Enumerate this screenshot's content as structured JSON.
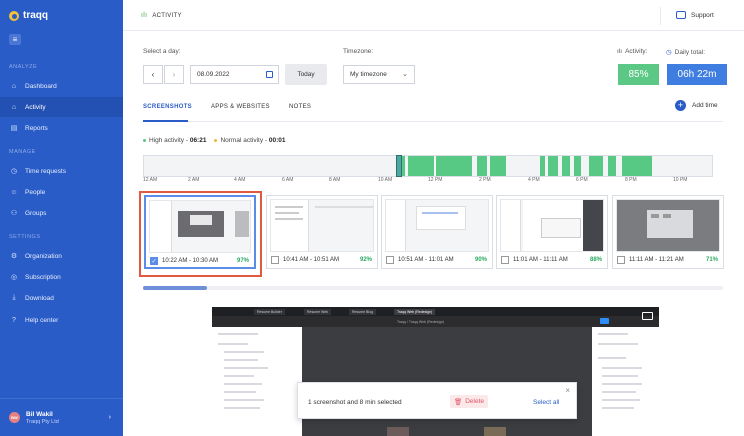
{
  "brand": {
    "name": "traqq"
  },
  "sidebar": {
    "sections": [
      {
        "label": "ANALYZE",
        "items": [
          {
            "label": "Dashboard",
            "icon": "home-icon"
          },
          {
            "label": "Activity",
            "icon": "activity-icon",
            "active": true
          },
          {
            "label": "Reports",
            "icon": "reports-icon"
          }
        ]
      },
      {
        "label": "MANAGE",
        "items": [
          {
            "label": "Time requests",
            "icon": "clock-icon"
          },
          {
            "label": "People",
            "icon": "people-icon"
          },
          {
            "label": "Groups",
            "icon": "groups-icon"
          }
        ]
      },
      {
        "label": "SETTINGS",
        "items": [
          {
            "label": "Organization",
            "icon": "organization-icon"
          },
          {
            "label": "Subscription",
            "icon": "subscription-icon"
          },
          {
            "label": "Download",
            "icon": "download-icon"
          },
          {
            "label": "Help center",
            "icon": "help-icon"
          }
        ]
      }
    ],
    "user": {
      "initials": "BW",
      "name": "Bil Wakil",
      "org": "Traqq Pty Ltd"
    }
  },
  "header": {
    "title": "ACTIVITY",
    "support": "Support"
  },
  "controls": {
    "day_label": "Select a day:",
    "date_value": "08.09.2022",
    "today_button": "Today",
    "timezone_label": "Timezone:",
    "timezone_value": "My timezone"
  },
  "stats": {
    "activity_label": "Activity:",
    "activity_value": "85%",
    "activity_color": "#5cc885",
    "daily_label": "Daily total:",
    "daily_value": "06h 22m",
    "daily_color": "#3f7de0"
  },
  "tabs": [
    {
      "label": "SCREENSHOTS",
      "active": true
    },
    {
      "label": "APPS & WEBSITES"
    },
    {
      "label": "NOTES"
    }
  ],
  "add_time": "Add time",
  "legend": {
    "high_label": "High activity",
    "high_value": "06:21",
    "high_color": "#57c985",
    "normal_label": "Normal activity",
    "normal_value": "00:01",
    "normal_color": "#f2b53a"
  },
  "timeline_ticks": [
    "12 AM",
    "2 AM",
    "4 AM",
    "6 AM",
    "8 AM",
    "10 AM",
    "12 PM",
    "2 PM",
    "4 PM",
    "6 PM",
    "8 PM",
    "10 PM"
  ],
  "screenshots": [
    {
      "time": "10:22 AM - 10:30 AM",
      "percent": "97%",
      "selected": true
    },
    {
      "time": "10:41 AM - 10:51 AM",
      "percent": "92%",
      "selected": false
    },
    {
      "time": "10:51 AM - 11:01 AM",
      "percent": "90%",
      "selected": false
    },
    {
      "time": "11:01 AM - 11:11 AM",
      "percent": "88%",
      "selected": false
    },
    {
      "time": "11:11 AM - 11:21 AM",
      "percent": "71%",
      "selected": false
    }
  ],
  "preview": {
    "tabs": [
      "Resume Builder",
      "Resume Web",
      "Resume Blog",
      "Traqq Web (Redesign)"
    ],
    "title": "Traqq / Traqq Web (Redesign)"
  },
  "toast": {
    "message": "1 screenshot and 8 min selected",
    "delete_label": "Delete",
    "select_all": "Select all"
  }
}
